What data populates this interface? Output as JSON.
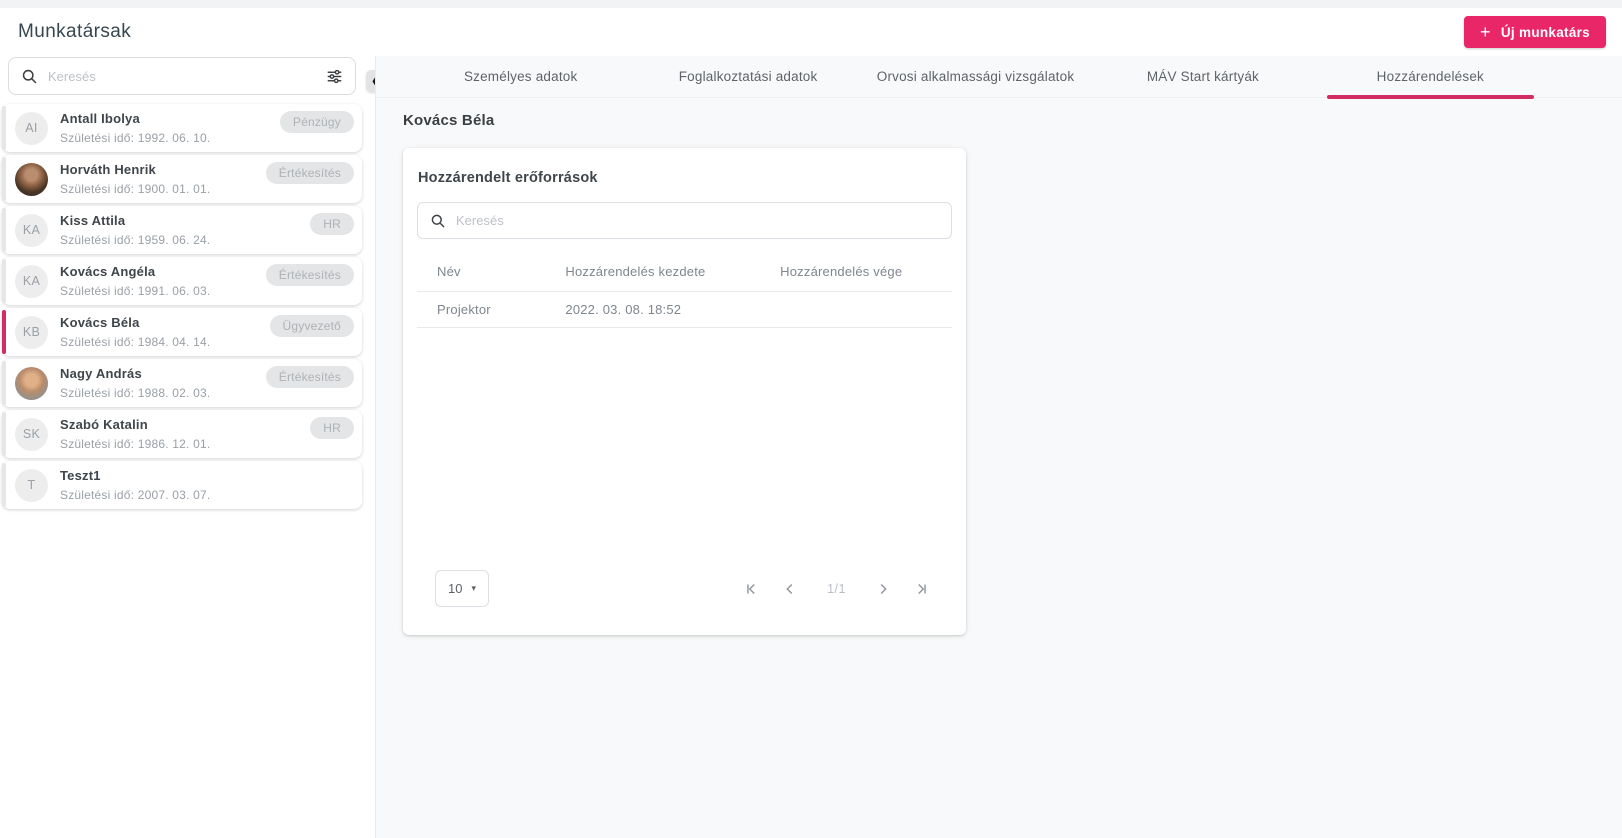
{
  "colors": {
    "accent": "#e92667",
    "accent_dark": "#d12d62"
  },
  "icons": {
    "plus": "+",
    "caret_down": "▾",
    "collapse": "❮",
    "search": "magnifier",
    "filter": "tune-sliders",
    "first_page": "|<",
    "prev_page": "<",
    "next_page": ">",
    "last_page": ">|"
  },
  "header": {
    "title": "Munkatársak",
    "new_employee_label": "Új munkatárs"
  },
  "sidebar": {
    "search_placeholder": "Keresés",
    "employees": [
      {
        "initials": "AI",
        "avatar": "initials",
        "name": "Antall Ibolya",
        "birth": "Születési idő: 1992. 06. 10.",
        "badge": "Pénzügy",
        "selected": false
      },
      {
        "initials": "",
        "avatar": "photo-1",
        "name": "Horváth Henrik",
        "birth": "Születési idő: 1900. 01. 01.",
        "badge": "Értékesítés",
        "selected": false
      },
      {
        "initials": "KA",
        "avatar": "initials",
        "name": "Kiss Attila",
        "birth": "Születési idő: 1959. 06. 24.",
        "badge": "HR",
        "selected": false
      },
      {
        "initials": "KA",
        "avatar": "initials",
        "name": "Kovács Angéla",
        "birth": "Születési idő: 1991. 06. 03.",
        "badge": "Értékesítés",
        "selected": false
      },
      {
        "initials": "KB",
        "avatar": "initials",
        "name": "Kovács Béla",
        "birth": "Születési idő: 1984. 04. 14.",
        "badge": "Ügyvezető",
        "selected": true
      },
      {
        "initials": "",
        "avatar": "photo-2",
        "name": "Nagy András",
        "birth": "Születési idő: 1988. 02. 03.",
        "badge": "Értékesítés",
        "selected": false
      },
      {
        "initials": "SK",
        "avatar": "initials",
        "name": "Szabó Katalin",
        "birth": "Születési idő: 1986. 12. 01.",
        "badge": "HR",
        "selected": false
      },
      {
        "initials": "T",
        "avatar": "initials",
        "name": "Teszt1",
        "birth": "Születési idő: 2007. 03. 07.",
        "badge": "",
        "selected": false
      }
    ]
  },
  "main": {
    "tabs": [
      {
        "label": "Személyes adatok",
        "active": false
      },
      {
        "label": "Foglalkoztatási adatok",
        "active": false
      },
      {
        "label": "Orvosi alkalmassági vizsgálatok",
        "active": false
      },
      {
        "label": "MÁV Start kártyák",
        "active": false
      },
      {
        "label": "Hozzárendelések",
        "active": true
      }
    ],
    "employee_name": "Kovács Béla",
    "card": {
      "title": "Hozzárendelt erőforrások",
      "search_placeholder": "Keresés",
      "table": {
        "columns": [
          {
            "label": "Név"
          },
          {
            "label": "Hozzárendelés kezdete"
          },
          {
            "label": "Hozzárendelés vége"
          }
        ],
        "rows": [
          {
            "name": "Projektor",
            "start": "2022. 03. 08. 18:52",
            "end": ""
          }
        ]
      },
      "pagination": {
        "page_size": "10",
        "range_label": "1/1"
      }
    }
  }
}
